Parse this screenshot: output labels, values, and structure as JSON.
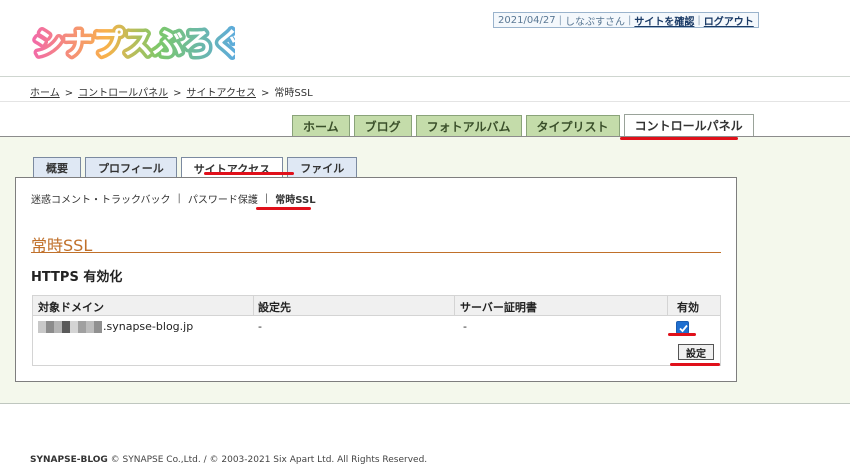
{
  "header": {
    "logo_text": "シナプスぶろぐ",
    "date": "2021/04/27",
    "user": "しなぷすさん",
    "check_site": "サイトを確認",
    "logout": "ログアウト"
  },
  "breadcrumb": {
    "items": [
      "ホーム",
      "コントロールパネル",
      "サイトアクセス"
    ],
    "current": "常時SSL"
  },
  "main_tabs": [
    {
      "label": "ホーム"
    },
    {
      "label": "ブログ"
    },
    {
      "label": "フォトアルバム"
    },
    {
      "label": "タイプリスト"
    },
    {
      "label": "コントロールパネル",
      "active": true
    }
  ],
  "sub_tabs": [
    {
      "label": "概要"
    },
    {
      "label": "プロフィール"
    },
    {
      "label": "サイトアクセス",
      "active": true
    },
    {
      "label": "ファイル"
    }
  ],
  "subnav": {
    "items": [
      "迷惑コメント・トラックバック",
      "パスワード保護"
    ],
    "current": "常時SSL"
  },
  "page": {
    "title": "常時SSL",
    "section_title": "HTTPS 有効化"
  },
  "table": {
    "headers": [
      "対象ドメイン",
      "設定先",
      "サーバー証明書",
      "有効"
    ],
    "row": {
      "domain": ".synapse-blog.jp",
      "target": "-",
      "certificate": "-",
      "enabled": true
    },
    "button_label": "設定"
  },
  "footer": {
    "brand": "SYNAPSE-BLOG",
    "text": " © SYNAPSE Co.,Ltd. / © 2003-2021 Six Apart Ltd. All Rights Reserved."
  },
  "colors": {
    "accent_title": "#c0702a",
    "highlight": "#e0101a",
    "main_tab_bg": "#c4dcaa",
    "sub_tab_bg": "#dfe8f4",
    "checkbox": "#1f6fd0"
  }
}
